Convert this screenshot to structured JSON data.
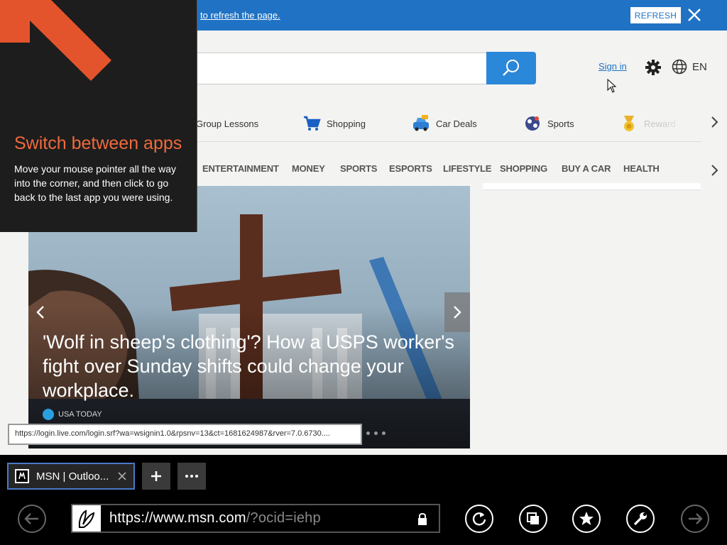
{
  "notification": {
    "link_text": "to refresh the page.",
    "refresh_label": "REFRESH",
    "close_icon": "close-icon"
  },
  "header": {
    "search_icon": "search-icon",
    "sign_in": "Sign in",
    "settings_icon": "gear-icon",
    "language_icon": "globe-icon",
    "language": "EN"
  },
  "quick_links": [
    {
      "label": "Group Lessons",
      "icon": "group-lessons-icon"
    },
    {
      "label": "Shopping",
      "icon": "shopping-cart-icon"
    },
    {
      "label": "Car Deals",
      "icon": "car-icon"
    },
    {
      "label": "Sports",
      "icon": "sports-ball-icon"
    },
    {
      "label": "Reward",
      "icon": "reward-medal-icon"
    }
  ],
  "nav": [
    "ENTERTAINMENT",
    "MONEY",
    "SPORTS",
    "ESPORTS",
    "LIFESTYLE",
    "SHOPPING",
    "BUY A CAR",
    "HEALTH"
  ],
  "hero": {
    "title": "'Wolf in sheep's clothing'? How a USPS worker's fight over Sunday shifts could change your workplace.",
    "source": "USA TODAY"
  },
  "status_url": "https://login.live.com/login.srf?wa=wsignin1.0&rpsnv=13&ct=1681624987&rver=7.0.6730....",
  "tip": {
    "title": "Switch between apps",
    "body": "Move your mouse pointer all the way into the corner, and then click to go back to the last app you were using."
  },
  "app_bar": {
    "tab_title": "MSN | Outloo...",
    "url_host": "https://www.msn.com",
    "url_rest": "/?ocid=iehp",
    "new_tab_icon": "plus-icon",
    "more_icon": "ellipsis-icon",
    "buttons": [
      "back-icon",
      "refresh-icon",
      "tabs-icon",
      "favorites-star-icon",
      "tools-wrench-icon",
      "forward-icon"
    ]
  },
  "colors": {
    "notification_bar": "#1f72c4",
    "search_button": "#2b87d8",
    "tip_accent": "#ef6a3c",
    "tab_border": "#4a78c7"
  }
}
